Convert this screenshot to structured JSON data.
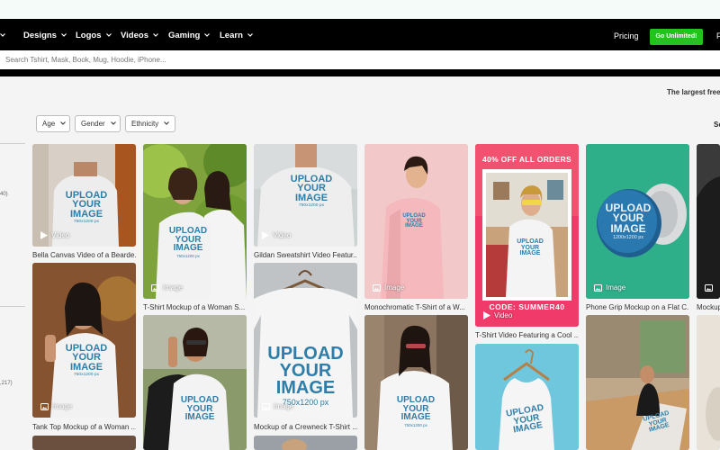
{
  "nav": {
    "items": [
      {
        "label": "Designs"
      },
      {
        "label": "Logos"
      },
      {
        "label": "Videos"
      },
      {
        "label": "Gaming"
      },
      {
        "label": "Learn"
      }
    ],
    "pricing": "Pricing",
    "cta": "Go Unlimited!",
    "cut_item": "F"
  },
  "search": {
    "placeholder": "Search Tshirt, Mask, Book, Mug, Hoodie, iPhone..."
  },
  "tagline": "The largest free",
  "sort_cut": "So",
  "filters": [
    {
      "label": "Age"
    },
    {
      "label": "Gender"
    },
    {
      "label": "Ethnicity"
    }
  ],
  "sidebar": {
    "num1": "40)",
    "num2": ",217)"
  },
  "upload_text": {
    "line1": "UPLOAD",
    "line2": "YOUR",
    "line3": "IMAGE",
    "size": "750x1200 px",
    "size_square": "1200x1200 px"
  },
  "badges": {
    "video": "Video",
    "image": "Image"
  },
  "cards": {
    "c1": {
      "caption": "Bella Canvas Video of a Bearde..."
    },
    "c2": {
      "caption": "Tank Top Mockup of a Woman ..."
    },
    "c3": {
      "caption": "T-Shirt Mockup of a Woman S..."
    },
    "c5": {
      "caption": "Gildan Sweatshirt Video Featur..."
    },
    "c6": {
      "caption": "Mockup of a Crewneck T-Shirt ..."
    },
    "c7": {
      "caption": "Monochromatic T-Shirt of a W..."
    },
    "c9": {
      "caption": "T-Shirt Video Featuring a Cool ..."
    },
    "c11": {
      "caption": "Phone Grip Mockup on a Flat C..."
    },
    "c13": {
      "caption": "Mockup"
    }
  },
  "promo": {
    "top": "40% OFF ALL ORDERS",
    "bottom": "CODE: SUMMER40"
  },
  "colors": {
    "accent_green": "#22c31c",
    "promo_pink": "#f03a6a"
  }
}
